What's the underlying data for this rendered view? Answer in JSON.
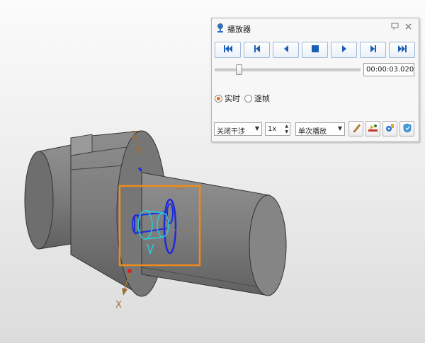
{
  "viewport": {
    "axis_z": "Z",
    "axis_x": "X"
  },
  "player": {
    "title": "播放器",
    "title_icon": "player-app-icon",
    "controls": {
      "first": "skip-to-start-icon",
      "prev_frame": "step-back-icon",
      "reverse": "play-reverse-icon",
      "stop": "stop-icon",
      "play": "play-icon",
      "next_frame": "step-forward-icon",
      "last": "skip-to-end-icon"
    },
    "progress_fraction": 0.15,
    "time": "00:00:03.020",
    "mode_options": [
      "实时",
      "逐帧"
    ],
    "mode_selected": "实时",
    "interference": "关闭干涉",
    "speed": "1x",
    "playback": "单次播放",
    "colors": {
      "accent_blue": "#1a5fb4",
      "radio_orange": "#e0701c",
      "highlight_box": "#f08a1a"
    }
  }
}
